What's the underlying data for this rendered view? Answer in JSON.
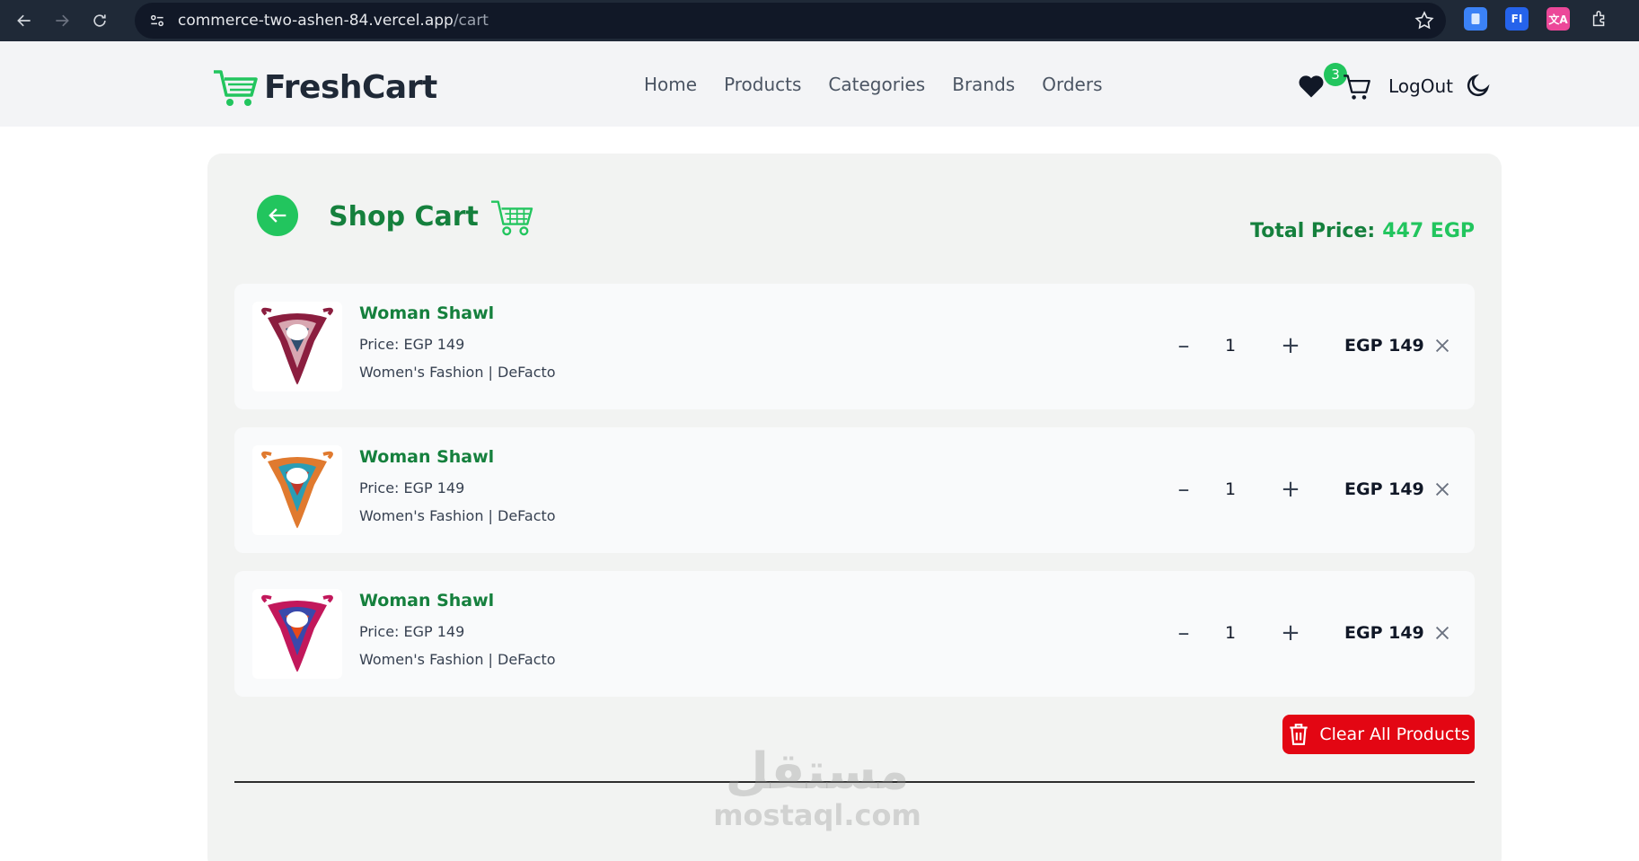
{
  "browser": {
    "url_host": "commerce-two-ashen-84.vercel.app",
    "url_path": "/cart",
    "extensions": [
      {
        "name": "docs-extension-icon",
        "color": "#3b82f6",
        "glyph": ""
      },
      {
        "name": "fi-extension-icon",
        "color": "#2563eb",
        "glyph": "FI"
      },
      {
        "name": "translate-extension-icon",
        "color": "#ec4899",
        "glyph": "文A"
      },
      {
        "name": "puzzle-extension-icon",
        "color": "transparent",
        "glyph": ""
      }
    ]
  },
  "navbar": {
    "brand": "FreshCart",
    "links": [
      "Home",
      "Products",
      "Categories",
      "Brands",
      "Orders"
    ],
    "cart_count": "3",
    "logout": "LogOut"
  },
  "cart": {
    "title": "Shop Cart",
    "total_label": "Total Price:",
    "total_value": "447 EGP",
    "items": [
      {
        "name": "Woman Shawl",
        "price": "Price: EGP 149",
        "meta": "Women's Fashion | DeFacto",
        "qty": "1",
        "minus": "–",
        "plus": "+",
        "line_price": "EGP 149",
        "colors": [
          "#8b1e3f",
          "#d8a7b1",
          "#2f4f6f"
        ]
      },
      {
        "name": "Woman Shawl",
        "price": "Price: EGP 149",
        "meta": "Women's Fashion | DeFacto",
        "qty": "1",
        "minus": "–",
        "plus": "+",
        "line_price": "EGP 149",
        "colors": [
          "#e07a2f",
          "#2a9db5",
          "#c0392b"
        ]
      },
      {
        "name": "Woman Shawl",
        "price": "Price: EGP 149",
        "meta": "Women's Fashion | DeFacto",
        "qty": "1",
        "minus": "–",
        "plus": "+",
        "line_price": "EGP 149",
        "colors": [
          "#c2185b",
          "#3949ab",
          "#e64a19"
        ]
      }
    ],
    "clear_label": "Clear All Products"
  },
  "watermark": {
    "arabic": "مستقل",
    "latin": "mostaql.com"
  },
  "colors": {
    "accent": "#22c55e",
    "accent_dark": "#15803d",
    "danger": "#e30613"
  }
}
